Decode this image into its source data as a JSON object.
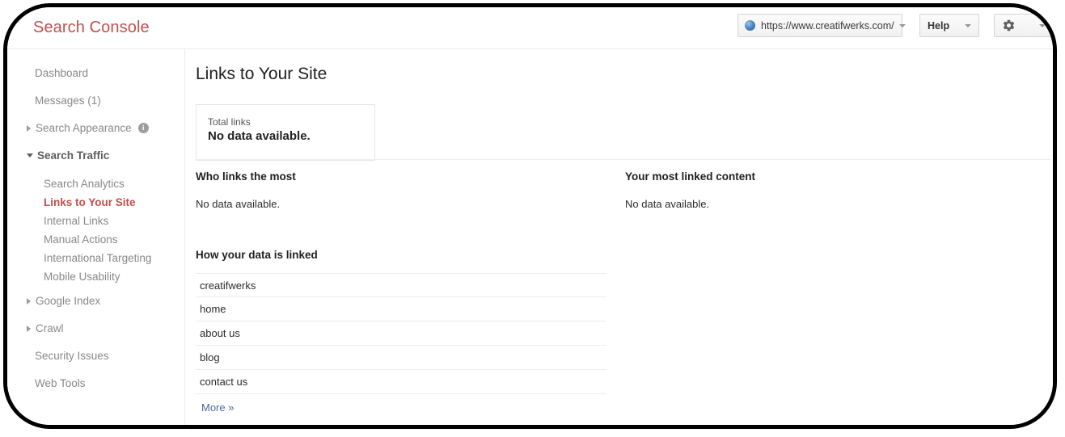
{
  "header": {
    "brand": "Search Console",
    "site_selector": {
      "url": "https://www.creatifwerks.com/",
      "favicon": "globe-icon",
      "caret": "chevron-down-icon"
    },
    "help_button": "Help",
    "settings_button_icon": "gear-icon"
  },
  "sidebar": {
    "items": [
      {
        "label": "Dashboard",
        "type": "top",
        "active": false
      },
      {
        "label": "Messages (1)",
        "type": "top",
        "active": false
      },
      {
        "label": "Search Appearance",
        "type": "group-collapsed",
        "info_icon": "info-icon",
        "active": false
      },
      {
        "label": "Search Traffic",
        "type": "group-expanded",
        "active": false
      },
      {
        "label": "Search Analytics",
        "type": "sub",
        "active": false
      },
      {
        "label": "Links to Your Site",
        "type": "sub",
        "active": true
      },
      {
        "label": "Internal Links",
        "type": "sub",
        "active": false
      },
      {
        "label": "Manual Actions",
        "type": "sub",
        "active": false
      },
      {
        "label": "International Targeting",
        "type": "sub",
        "active": false
      },
      {
        "label": "Mobile Usability",
        "type": "sub",
        "active": false
      },
      {
        "label": "Google Index",
        "type": "group-collapsed",
        "active": false
      },
      {
        "label": "Crawl",
        "type": "group-collapsed",
        "active": false
      },
      {
        "label": "Security Issues",
        "type": "top",
        "active": false
      },
      {
        "label": "Web Tools",
        "type": "top",
        "active": false
      }
    ]
  },
  "main": {
    "page_title": "Links to Your Site",
    "total_links_card": {
      "label": "Total links",
      "value": "No data available."
    },
    "who_links_the_most": {
      "heading": "Who links the most",
      "body": "No data available."
    },
    "your_most_linked_content": {
      "heading": "Your most linked content",
      "body": "No data available."
    },
    "how_your_data_is_linked": {
      "heading": "How your data is linked",
      "rows": [
        "creatifwerks",
        "home",
        "about us",
        "blog",
        "contact us"
      ],
      "more_link": "More »"
    }
  },
  "colors": {
    "brand_red": "#c0504d",
    "link_blue": "#4a6a9a",
    "text_gray": "#888888",
    "border_gray": "#ececec",
    "frame_black": "#000000"
  }
}
